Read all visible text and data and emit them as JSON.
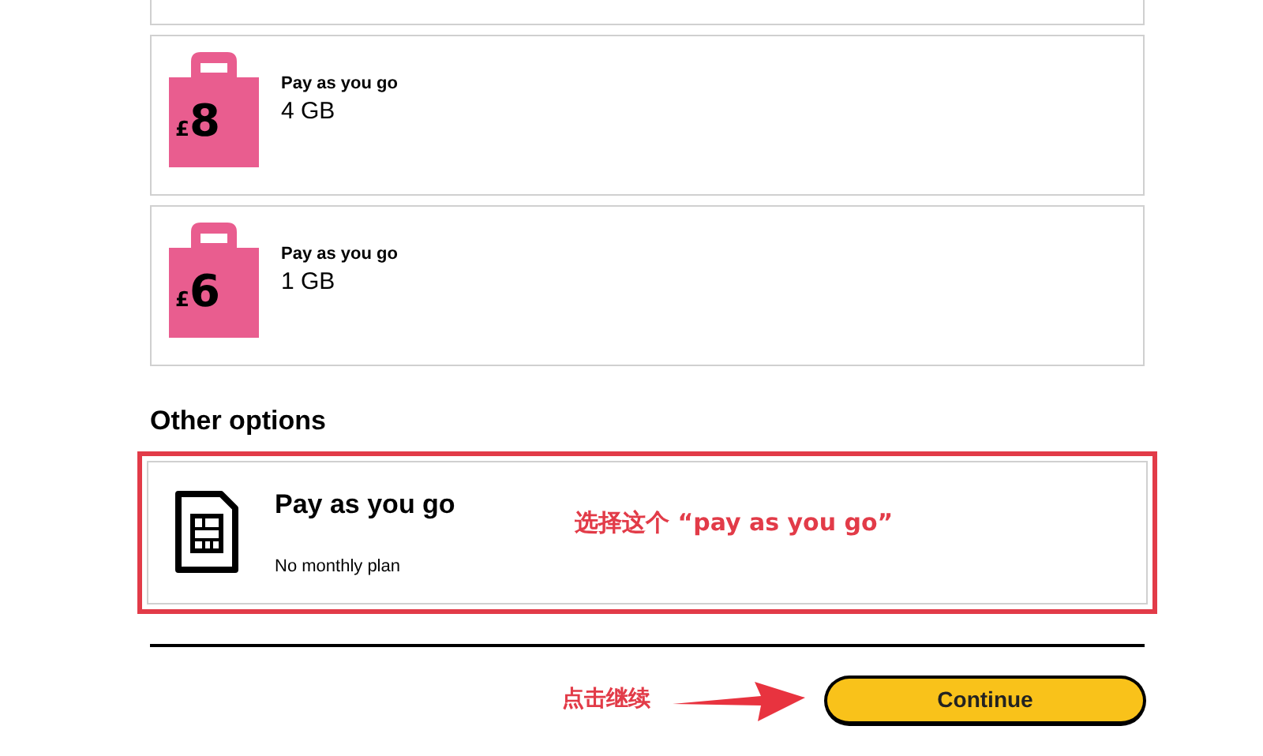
{
  "plans": [
    {
      "currency": "£",
      "price": "8",
      "label": "Pay as you go",
      "data": "4 GB"
    },
    {
      "currency": "£",
      "price": "6",
      "label": "Pay as you go",
      "data": "1 GB"
    }
  ],
  "other_options": {
    "heading": "Other options",
    "option": {
      "title": "Pay as you go",
      "subtitle": "No monthly plan",
      "highlighted": true,
      "note": "选择这个 “pay as you go”"
    }
  },
  "continue": {
    "label": "Continue",
    "note": "点击继续"
  }
}
